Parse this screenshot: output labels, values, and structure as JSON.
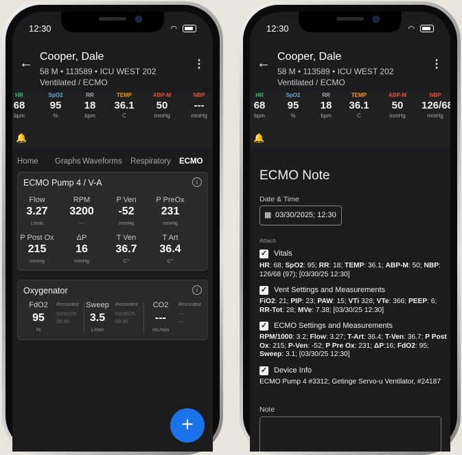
{
  "status_time": "12:30",
  "patient": {
    "name": "Cooper, Dale",
    "info": "58 M • 113589 • ICU WEST 202",
    "status": "Ventilated / ECMO"
  },
  "vitals_left": [
    {
      "label": "HR",
      "value": "68",
      "unit": "bpm",
      "color": "#2ecc71"
    },
    {
      "label": "SpO2",
      "value": "95",
      "unit": "%",
      "color": "#5dade2"
    },
    {
      "label": "RR",
      "value": "18",
      "unit": "bpm",
      "color": "#aaaaaa"
    },
    {
      "label": "TEMP",
      "value": "36.1",
      "unit": "C",
      "color": "#f39c12"
    },
    {
      "label": "ABP-M",
      "value": "50",
      "unit": "mmHg",
      "color": "#e74c3c"
    },
    {
      "label": "NBP",
      "value": "---",
      "unit": "mmHg",
      "color": "#e74c3c"
    }
  ],
  "vitals_right": [
    {
      "label": "HR",
      "value": "68",
      "unit": "bpm",
      "color": "#2ecc71"
    },
    {
      "label": "SpO2",
      "value": "95",
      "unit": "%",
      "color": "#5dade2"
    },
    {
      "label": "RR",
      "value": "18",
      "unit": "bpm",
      "color": "#aaaaaa"
    },
    {
      "label": "TEMP",
      "value": "36.1",
      "unit": "C",
      "color": "#f39c12"
    },
    {
      "label": "ABP-M",
      "value": "50",
      "unit": "mmHg",
      "color": "#e74c3c"
    },
    {
      "label": "NBP",
      "value": "126/68",
      "unit": "mmHg",
      "color": "#e74c3c"
    }
  ],
  "tabs": [
    "Home",
    "Graphs",
    "Waveforms",
    "Respiratory",
    "ECMO"
  ],
  "active_tab": "ECMO",
  "pump_card": {
    "title": "ECMO Pump 4 / V-A",
    "metrics": [
      {
        "label": "Flow",
        "value": "3.27",
        "unit": "L/min"
      },
      {
        "label": "RPM",
        "value": "3200",
        "unit": "---"
      },
      {
        "label": "P Ven",
        "value": "-52",
        "unit": "mmHg"
      },
      {
        "label": "P PreOx",
        "value": "231",
        "unit": "mmHg"
      },
      {
        "label": "P Post Ox",
        "value": "215",
        "unit": "mmHg"
      },
      {
        "label": "ΔP",
        "value": "16",
        "unit": "mmHg"
      },
      {
        "label": "T Ven",
        "value": "36.7",
        "unit": "C°"
      },
      {
        "label": "T Art",
        "value": "36.4",
        "unit": "C°"
      }
    ]
  },
  "oxygenator": {
    "title": "Oxygenator",
    "recorded_label": "Recorded",
    "items": [
      {
        "label": "FdO2",
        "value": "95",
        "unit": "%",
        "rec_date": "03/30/25",
        "rec_time": "09:30"
      },
      {
        "label": "Sweep",
        "value": "3.5",
        "unit": "L/min",
        "rec_date": "03/30/25",
        "rec_time": "09:30"
      },
      {
        "label": "CO2",
        "value": "---",
        "unit": "mL/min",
        "rec_date": "---",
        "rec_time": "---"
      }
    ]
  },
  "note": {
    "title": "ECMO Note",
    "datetime_label": "Date & Time",
    "datetime_value": "03/30/2025; 12:30",
    "attach_label": "Attach",
    "vitals_label": "Vitals",
    "vitals_text": [
      [
        "HR",
        ": 68; "
      ],
      [
        "SpO2",
        ": 95; "
      ],
      [
        "RR",
        ": 18; "
      ],
      [
        "TEMP",
        ": 36.1; "
      ],
      [
        "ABP-M",
        ": 50; "
      ],
      [
        "NBP",
        ": 126/68 (97); [03/30/25 12:30]"
      ]
    ],
    "vent_label": "Vent Settings and Measurements",
    "vent_text": [
      [
        "FiO2",
        ": 21; "
      ],
      [
        "PIP",
        ": 23; "
      ],
      [
        "PAW",
        ": 15; "
      ],
      [
        "VTi",
        " 328; "
      ],
      [
        "VTe",
        ": 366; "
      ],
      [
        "PEEP",
        ": 6; "
      ],
      [
        "RR-Tot",
        ": 28; "
      ],
      [
        "MVe",
        ": 7.38; [03/30/25 12:30]"
      ]
    ],
    "ecmo_label": "ECMO Settings and Measurements",
    "ecmo_text": [
      [
        "RPM/1000",
        ": 3.2; "
      ],
      [
        "Flow",
        ": 3.27; "
      ],
      [
        "T-Art",
        ": 36.4; "
      ],
      [
        "T-Ven",
        ": 36.7; "
      ],
      [
        "P Post Ox",
        ": 215; "
      ],
      [
        "P-Ven",
        ": -52; "
      ],
      [
        "P Pre Ox",
        ": 231; "
      ],
      [
        "ΔP",
        ":16; "
      ],
      [
        "FdO2",
        ": 95; "
      ],
      [
        "Sweep",
        ": 3.1; [03/30/25 12:30]"
      ]
    ],
    "device_label": "Device Info",
    "device_text": "ECMO Pump 4 #3312; Getinge Servo-u Ventilator, #24187",
    "note_label": "Note"
  },
  "colors": {
    "accent": "#1a73e8",
    "background": "#1c1c1e"
  }
}
